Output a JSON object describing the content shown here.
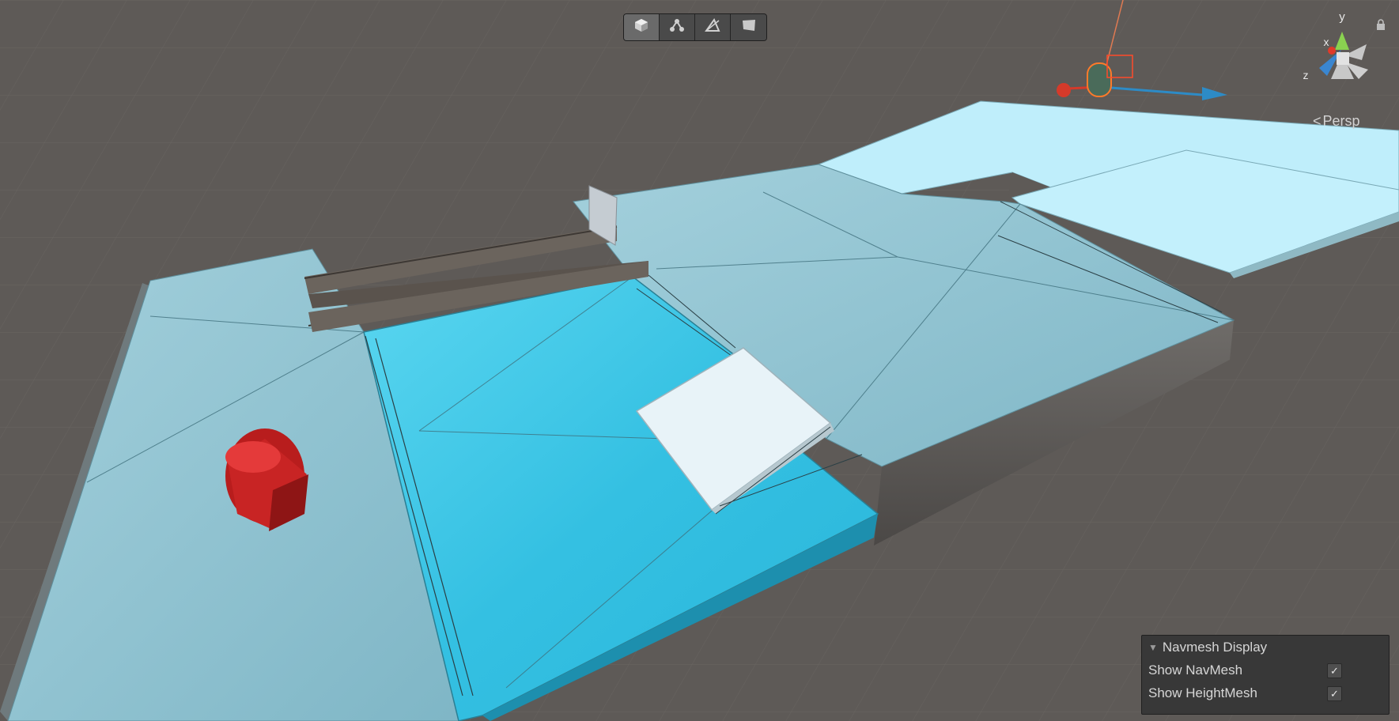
{
  "toolbar": {
    "tools": [
      {
        "icon": "cube-icon",
        "active": true
      },
      {
        "icon": "nodes-icon",
        "active": false
      },
      {
        "icon": "triangle-ruler-icon",
        "active": false
      },
      {
        "icon": "quad-icon",
        "active": false
      }
    ]
  },
  "gizmo": {
    "axis_y": "y",
    "axis_x": "x",
    "axis_z": "z",
    "projection_label": "Persp"
  },
  "navmesh_panel": {
    "title": "Navmesh Display",
    "options": [
      {
        "label": "Show NavMesh",
        "checked": true
      },
      {
        "label": "Show HeightMesh",
        "checked": true
      }
    ]
  },
  "colors": {
    "background": "#5e5a57",
    "ice": "#8fc3d1",
    "water": "#38c6e3",
    "platform_light": "#bfeefb",
    "capsule": "#c81f1f",
    "panel": "#383838"
  }
}
